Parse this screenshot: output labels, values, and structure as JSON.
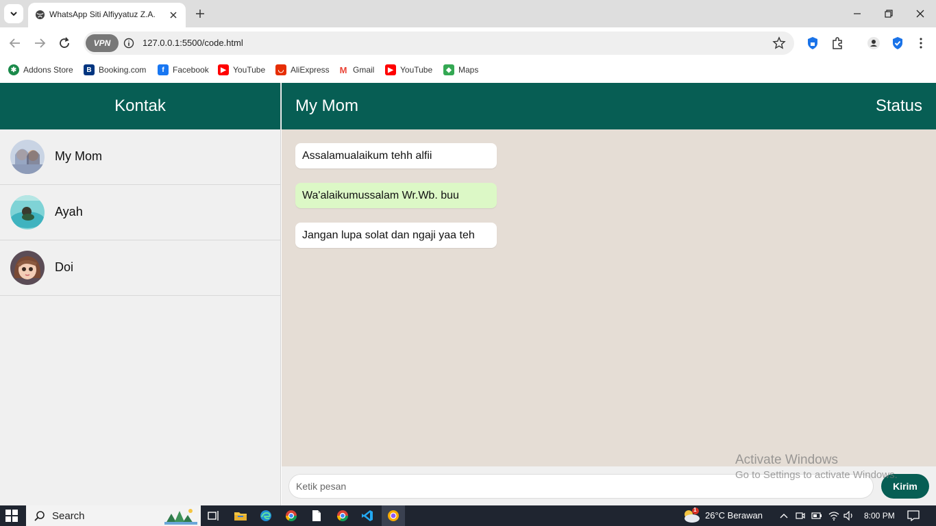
{
  "browser": {
    "tab_title": "WhatsApp Siti Alfiyyatuz Z.A.",
    "url": "127.0.0.1:5500/code.html",
    "vpn_label": "VPN"
  },
  "bookmarks": [
    {
      "label": "Addons Store",
      "icon": "addons-store-icon",
      "color": "#1a8a4a"
    },
    {
      "label": "Booking.com",
      "icon": "booking-icon",
      "color": "#003580"
    },
    {
      "label": "Facebook",
      "icon": "facebook-icon",
      "color": "#1877f2"
    },
    {
      "label": "YouTube",
      "icon": "youtube-icon",
      "color": "#ff0000"
    },
    {
      "label": "AliExpress",
      "icon": "aliexpress-icon",
      "color": "#e62e04"
    },
    {
      "label": "Gmail",
      "icon": "gmail-icon",
      "color": "#ea4335"
    },
    {
      "label": "YouTube",
      "icon": "youtube-icon",
      "color": "#ff0000"
    },
    {
      "label": "Maps",
      "icon": "maps-icon",
      "color": "#34a853"
    }
  ],
  "sidebar": {
    "title": "Kontak",
    "contacts": [
      {
        "name": "My Mom"
      },
      {
        "name": "Ayah"
      },
      {
        "name": "Doi"
      }
    ]
  },
  "chat": {
    "contact_name": "My Mom",
    "status_label": "Status",
    "messages": [
      {
        "text": "Assalamualaikum tehh alfii",
        "direction": "in"
      },
      {
        "text": "Wa'alaikumussalam Wr.Wb. buu",
        "direction": "out"
      },
      {
        "text": "Jangan lupa solat dan ngaji yaa teh",
        "direction": "in"
      }
    ],
    "input_placeholder": "Ketik pesan",
    "send_label": "Kirim"
  },
  "watermark": {
    "line1": "Activate Windows",
    "line2": "Go to Settings to activate Windows."
  },
  "taskbar": {
    "search_label": "Search",
    "weather": "26°C  Berawan",
    "time": "8:00 PM",
    "weather_badge": "1"
  },
  "colors": {
    "header_green": "#075e54",
    "chat_bg": "#e5ddd5",
    "outgoing_bubble": "#dcf8c6"
  }
}
